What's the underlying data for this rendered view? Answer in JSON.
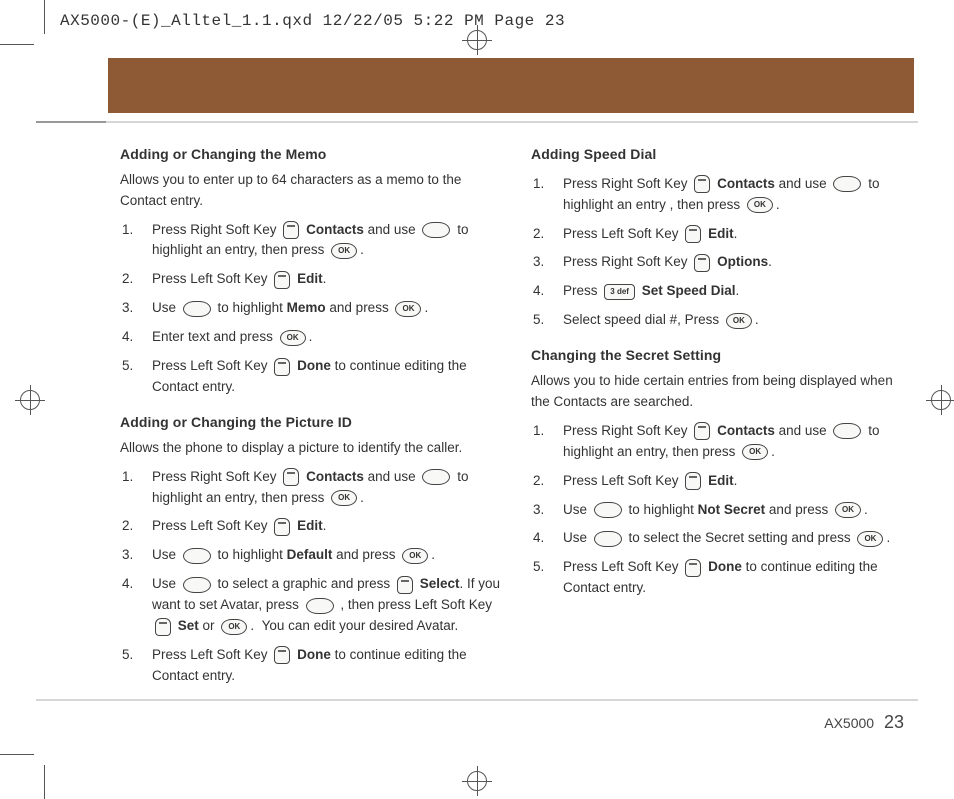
{
  "header": "AX5000-(E)_Alltel_1.1.qxd  12/22/05  5:22 PM  Page 23",
  "n": {
    "1": "1.",
    "2": "2.",
    "3": "3.",
    "4": "4.",
    "5": "5."
  },
  "w": {
    "contacts": "Contacts",
    "edit": "Edit",
    "memo": "Memo",
    "done": "Done",
    "use": "Use",
    "andpress": "and press",
    "default": "Default",
    "select": "Select",
    "set": "Set",
    "or": "or",
    "options": "Options",
    "press": "Press",
    "key3": "3 def",
    "setspeed": "Set Speed Dial",
    "notsecret": "Not Secret"
  },
  "left": {
    "sec1": {
      "title": "Adding or Changing the Memo",
      "desc": "Allows you to enter up to 64 characters as a memo to the Contact entry.",
      "s1a": "Press Right Soft Key ",
      "s1b": "and use",
      "s1c": "to highlight an entry, then press",
      "s2a": "Press Left Soft Key ",
      "s3a": "to highlight",
      "s4a": "Enter text and press",
      "s5a": "to continue editing the Contact entry."
    },
    "sec2": {
      "title": "Adding or Changing the Picture ID",
      "desc": "Allows the phone to display a picture to identify the caller.",
      "s4a": "to select a graphic and press",
      "s4b": "If you want to set Avatar, press",
      "s4c": ", then press Left Soft Key",
      "s4d": "You can edit your desired Avatar.",
      "s5a": "to continue editing the Contact entry."
    }
  },
  "right": {
    "sec1": {
      "title": "Adding Speed Dial",
      "s1c": "to highlight an entry , then press",
      "s5a": "Select speed dial #, Press"
    },
    "sec2": {
      "title": "Changing the Secret Setting",
      "desc": "Allows you to hide certain entries from being displayed when the Contacts are searched.",
      "s4a": "to select the Secret setting and press"
    }
  },
  "footer": {
    "model": "AX5000",
    "page": "23"
  }
}
